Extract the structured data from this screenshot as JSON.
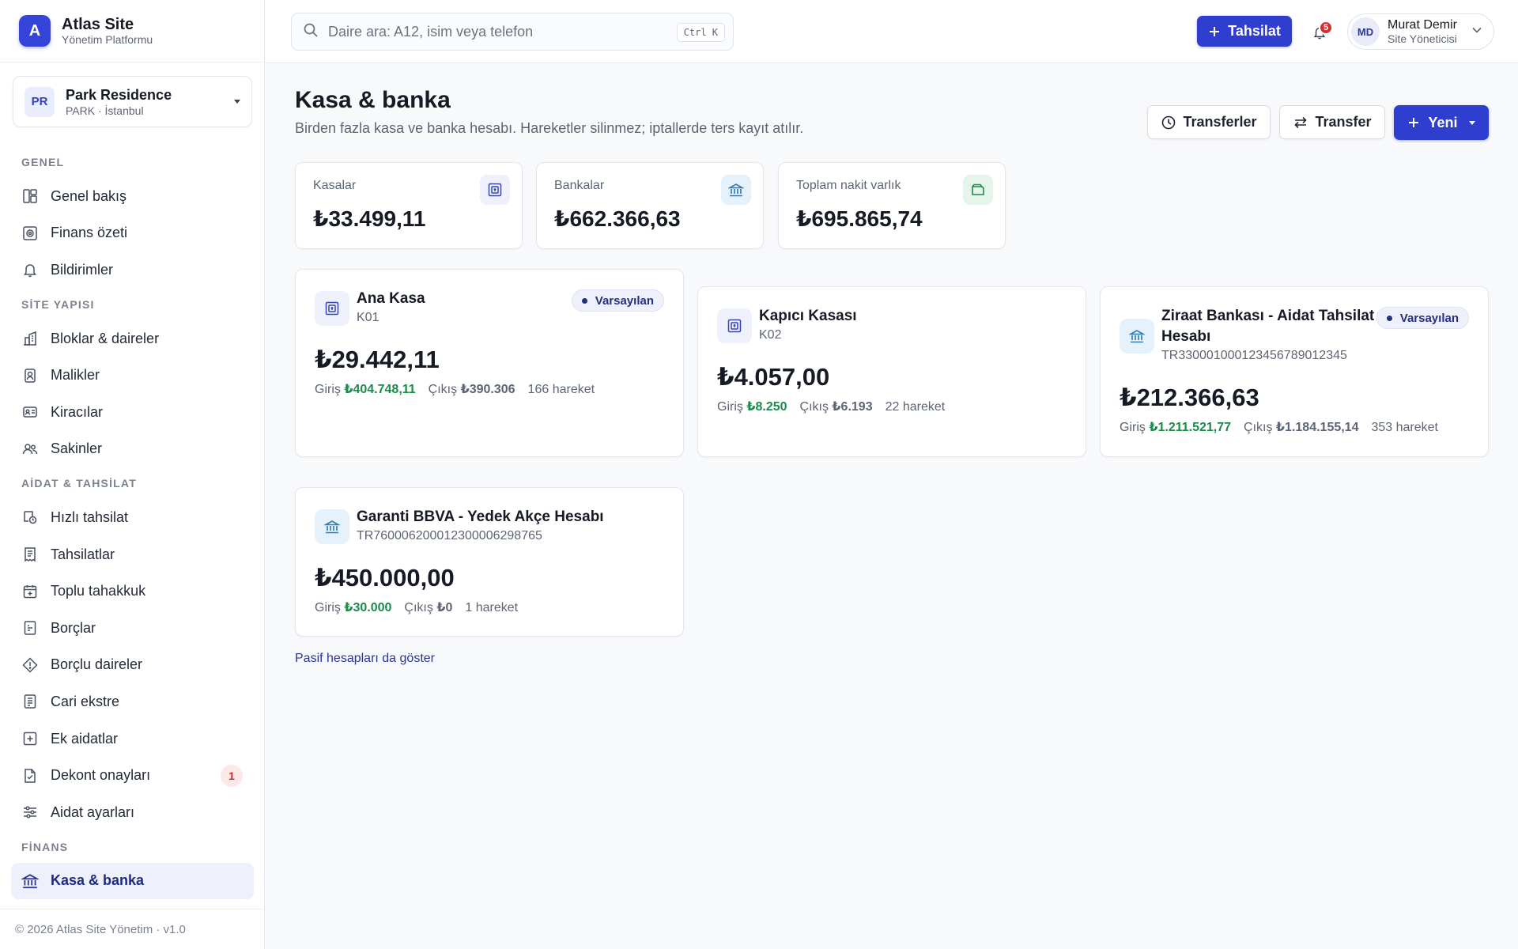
{
  "brand": {
    "logo_letter": "A",
    "name": "Atlas Site",
    "subtitle": "Yönetim Platformu"
  },
  "site": {
    "initials": "PR",
    "name": "Park Residence",
    "meta": "PARK · İstanbul"
  },
  "nav": {
    "sections": [
      {
        "title": "GENEL",
        "items": [
          {
            "label": "Genel bakış",
            "icon": "dashboard-icon"
          },
          {
            "label": "Finans özeti",
            "icon": "finance-summary-icon"
          },
          {
            "label": "Bildirimler",
            "icon": "bell-icon"
          }
        ]
      },
      {
        "title": "SİTE YAPISI",
        "items": [
          {
            "label": "Bloklar & daireler",
            "icon": "building-icon"
          },
          {
            "label": "Malikler",
            "icon": "owner-icon"
          },
          {
            "label": "Kiracılar",
            "icon": "id-card-icon"
          },
          {
            "label": "Sakinler",
            "icon": "users-icon"
          }
        ]
      },
      {
        "title": "AİDAT & TAHSİLAT",
        "items": [
          {
            "label": "Hızlı tahsilat",
            "icon": "quick-collect-icon"
          },
          {
            "label": "Tahsilatlar",
            "icon": "receipt-icon"
          },
          {
            "label": "Toplu tahakkuk",
            "icon": "calendar-plus-icon"
          },
          {
            "label": "Borçlar",
            "icon": "debt-icon"
          },
          {
            "label": "Borçlu daireler",
            "icon": "alert-diamond-icon"
          },
          {
            "label": "Cari ekstre",
            "icon": "statement-icon"
          },
          {
            "label": "Ek aidatlar",
            "icon": "plus-square-icon"
          },
          {
            "label": "Dekont onayları",
            "icon": "file-check-icon",
            "badge": "1"
          },
          {
            "label": "Aidat ayarları",
            "icon": "sliders-icon"
          }
        ]
      },
      {
        "title": "FİNANS",
        "items": [
          {
            "label": "Kasa & banka",
            "icon": "bank-icon",
            "active": true
          }
        ]
      }
    ]
  },
  "footer": "© 2026 Atlas Site Yönetim · v1.0",
  "header": {
    "search_placeholder": "Daire ara: A12, isim veya telefon",
    "search_shortcut": "Ctrl K",
    "collect_button": "Tahsilat",
    "notifications_count": "5",
    "user": {
      "initials": "MD",
      "name": "Murat Demir",
      "role": "Site Yöneticisi"
    }
  },
  "page": {
    "title": "Kasa & banka",
    "description": "Birden fazla kasa ve banka hesabı. Hareketler silinmez; iptallerde ters kayıt atılır.",
    "actions": {
      "transfers": "Transferler",
      "transfer": "Transfer",
      "new": "Yeni"
    }
  },
  "stats": [
    {
      "label": "Kasalar",
      "value": "₺33.499,11",
      "icon": "cash-register-icon",
      "color": "#eef0fb"
    },
    {
      "label": "Bankalar",
      "value": "₺662.366,63",
      "icon": "bank-icon",
      "color": "#e8f3fb"
    },
    {
      "label": "Toplam nakit varlık",
      "value": "₺695.865,74",
      "icon": "wallet-icon",
      "color": "#e8f6ee"
    }
  ],
  "accounts": [
    {
      "name": "Ana Kasa",
      "code": "K01",
      "balance": "₺29.442,11",
      "in_label": "Giriş",
      "in": "₺404.748,11",
      "out_label": "Çıkış",
      "out": "₺390.306",
      "moves": "166 hareket",
      "default_label": "Varsayılan",
      "type": "cash"
    },
    {
      "name": "Kapıcı Kasası",
      "code": "K02",
      "balance": "₺4.057,00",
      "in_label": "Giriş",
      "in": "₺8.250",
      "out_label": "Çıkış",
      "out": "₺6.193",
      "moves": "22 hareket",
      "type": "cash"
    },
    {
      "name_line1": "Ziraat Bankası - Aidat Tahsilat",
      "name_line2": "Hesabı",
      "code": "TR330001000123456789012345",
      "balance": "₺212.366,63",
      "in_label": "Giriş",
      "in": "₺1.211.521,77",
      "out_label": "Çıkış",
      "out": "₺1.184.155,14",
      "moves": "353 hareket",
      "default_label": "Varsayılan",
      "type": "bank"
    },
    {
      "name": "Garanti BBVA - Yedek Akçe Hesabı",
      "code": "TR760006200012300006298765",
      "balance": "₺450.000,00",
      "in_label": "Giriş",
      "in": "₺30.000",
      "out_label": "Çıkış",
      "out": "₺0",
      "moves": "1 hareket",
      "type": "bank"
    }
  ],
  "show_passive": "Pasif hesapları da göster",
  "colors": {
    "primary": "#2f3ecf",
    "income": "#1b8a4a",
    "badge_red": "#d32f2f"
  }
}
